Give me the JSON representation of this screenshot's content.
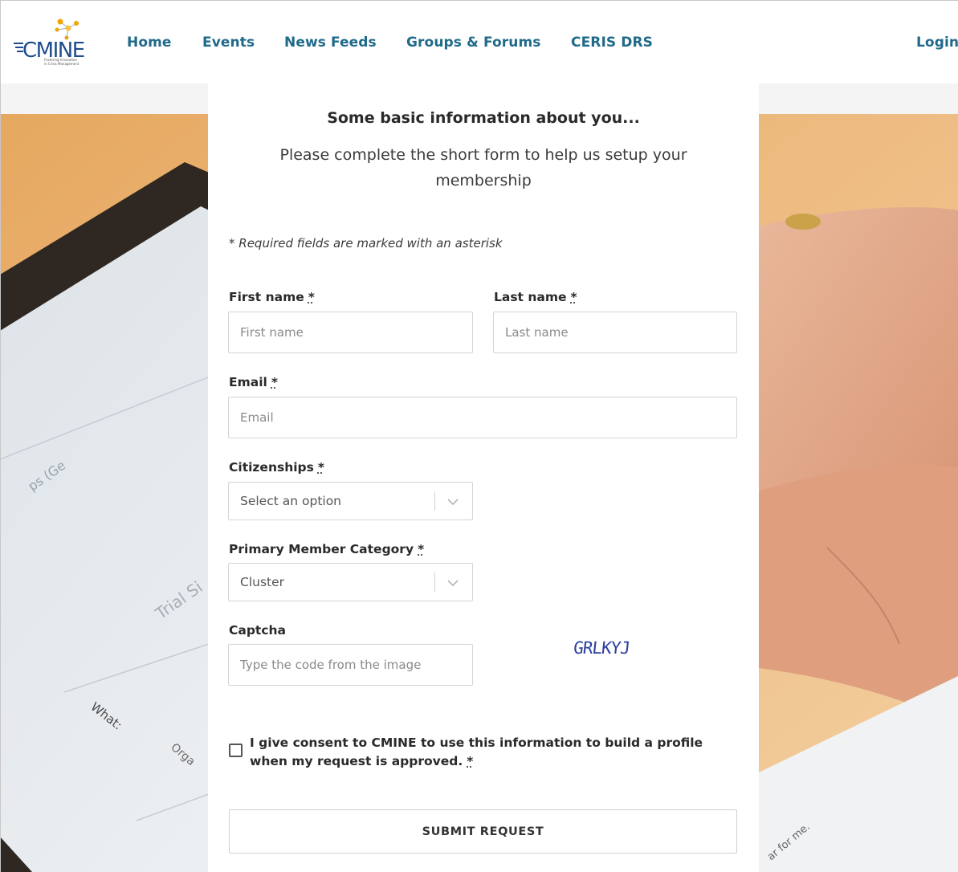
{
  "nav": {
    "items": [
      {
        "label": "Home"
      },
      {
        "label": "Events"
      },
      {
        "label": "News Feeds"
      },
      {
        "label": "Groups & Forums"
      },
      {
        "label": "CERIS DRS"
      }
    ],
    "login": "Login"
  },
  "logo": {
    "name": "CMINE",
    "tagline_line1": "Fostering Innovation",
    "tagline_line2": "in Crisis Management"
  },
  "form": {
    "heading": "Some basic information about you...",
    "subheading": "Please complete the short form to help us setup your membership",
    "required_note": "* Required fields are marked with an asterisk",
    "asterisk": "*",
    "first_name": {
      "label": "First name",
      "placeholder": "First name",
      "value": ""
    },
    "last_name": {
      "label": "Last name",
      "placeholder": "Last name",
      "value": ""
    },
    "email": {
      "label": "Email",
      "placeholder": "Email",
      "value": ""
    },
    "citizenships": {
      "label": "Citizenships",
      "selected": "Select an option"
    },
    "member_category": {
      "label": "Primary Member Category",
      "selected": "Cluster"
    },
    "captcha": {
      "label": "Captcha",
      "placeholder": "Type the code from the image",
      "code": "GRLKYJ"
    },
    "consent": {
      "text": "I give consent to CMINE to use this information to build a profile when my request is approved.",
      "checked": false
    },
    "submit_label": "SUBMIT REQUEST"
  },
  "background_text": {
    "left_what": "What:",
    "left_orga": "Orga",
    "left_title": "Trial Si",
    "left_top": "ps (Ge",
    "right_bottom": "ar for me."
  },
  "colors": {
    "nav_link": "#1f6a8a",
    "logo_blue": "#1e4c8c",
    "logo_accent": "#f2a400",
    "captcha_ink": "#2b3f9c",
    "background_warm": "#e8b070"
  },
  "icons": {
    "select_chevron": "chevron-down-icon"
  }
}
